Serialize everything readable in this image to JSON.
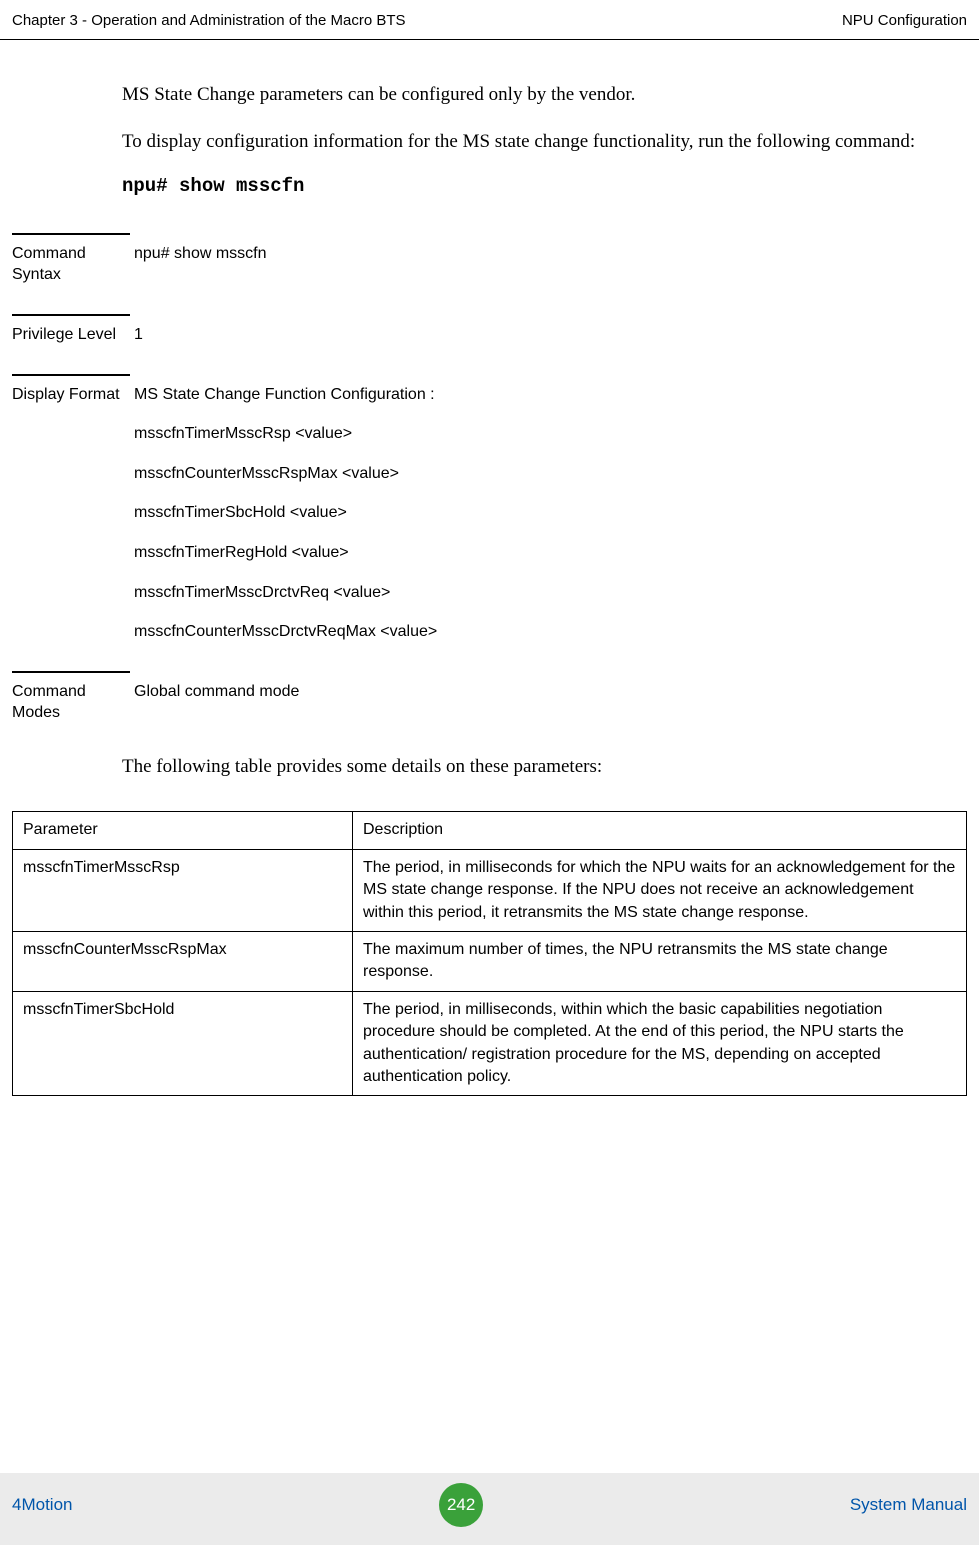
{
  "header": {
    "left": "Chapter 3 - Operation and Administration of the Macro BTS",
    "right": "NPU Configuration"
  },
  "intro": {
    "p1": "MS State Change parameters can be configured only by the vendor.",
    "p2": "To display configuration information for the MS state change functionality, run the following command:",
    "command": "npu# show msscfn"
  },
  "sections": {
    "commandSyntax": {
      "label": "Command Syntax",
      "value": "npu# show msscfn"
    },
    "privilegeLevel": {
      "label": "Privilege Level",
      "value": "1"
    },
    "displayFormat": {
      "label": "Display Format",
      "lines": [
        "MS State Change Function Configuration :",
        "msscfnTimerMsscRsp <value>",
        "msscfnCounterMsscRspMax <value>",
        "msscfnTimerSbcHold <value>",
        "msscfnTimerRegHold <value>",
        "msscfnTimerMsscDrctvReq <value>",
        "msscfnCounterMsscDrctvReqMax <value>"
      ]
    },
    "commandModes": {
      "label": "Command Modes",
      "value": "Global command mode"
    }
  },
  "paramIntro": "The following table provides some details on these parameters:",
  "paramTable": {
    "headers": [
      "Parameter",
      "Description"
    ],
    "rows": [
      {
        "param": "msscfnTimerMsscRsp",
        "desc": "The period, in milliseconds for which the NPU waits for an acknowledgement for the MS state change response. If the NPU does not receive an acknowledgement within this period, it retransmits the MS state change response."
      },
      {
        "param": "msscfnCounterMsscRspMax",
        "desc": "The maximum number of times, the NPU retransmits the MS state change response."
      },
      {
        "param": "msscfnTimerSbcHold",
        "desc": "The period, in milliseconds, within which the basic capabilities negotiation procedure should be completed. At the end of this period, the NPU starts the authentication/ registration procedure for the MS, depending on accepted authentication policy."
      }
    ]
  },
  "footer": {
    "left": "4Motion",
    "page": "242",
    "right": "System Manual"
  }
}
